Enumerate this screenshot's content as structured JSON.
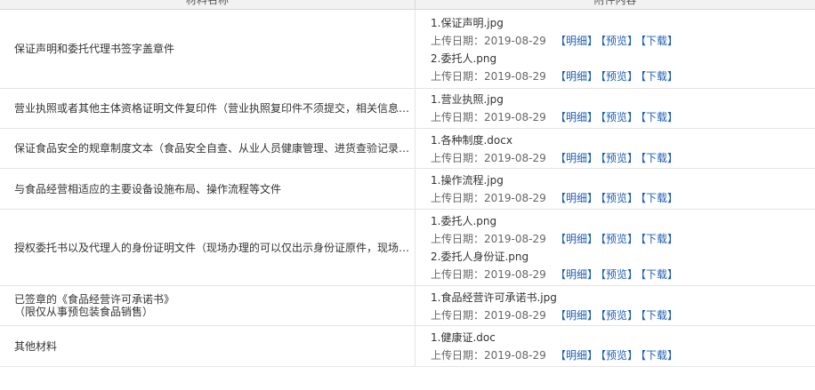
{
  "header": {
    "col_name": "材料名称",
    "col_content": "附件内容"
  },
  "actions": {
    "detail": "【明细】",
    "preview": "【预览】",
    "download": "【下载】"
  },
  "upload_label": "上传日期：",
  "rows": [
    {
      "name": "保证声明和委托代理书签字盖章件",
      "files": [
        {
          "name": "1.保证声明.jpg",
          "date": "2019-08-29"
        },
        {
          "name": "2.委托人.png",
          "date": "2019-08-29"
        }
      ]
    },
    {
      "name": "营业执照或者其他主体资格证明文件复印件（营业执照复印件不须提交，相关信息…",
      "files": [
        {
          "name": "1.营业执照.jpg",
          "date": "2019-08-29"
        }
      ]
    },
    {
      "name": "保证食品安全的规章制度文本（食品安全自查、从业人员健康管理、进货查验记录…",
      "files": [
        {
          "name": "1.各种制度.docx",
          "date": "2019-08-29"
        }
      ]
    },
    {
      "name": "与食品经营相适应的主要设备设施布局、操作流程等文件",
      "files": [
        {
          "name": "1.操作流程.jpg",
          "date": "2019-08-29"
        }
      ]
    },
    {
      "name": "授权委托书以及代理人的身份证明文件（现场办理的可以仅出示身份证原件，现场…",
      "files": [
        {
          "name": "1.委托人.png",
          "date": "2019-08-29"
        },
        {
          "name": "2.委托人身份证.png",
          "date": "2019-08-29"
        }
      ]
    },
    {
      "name_line1": "已签章的《食品经营许可承诺书》",
      "name_line2": "（限仅从事预包装食品销售）",
      "files": [
        {
          "name": "1.食品经营许可承诺书.jpg",
          "date": "2019-08-29"
        }
      ]
    },
    {
      "name": "其他材料",
      "files": [
        {
          "name": "1.健康证.doc",
          "date": "2019-08-29"
        }
      ]
    }
  ]
}
